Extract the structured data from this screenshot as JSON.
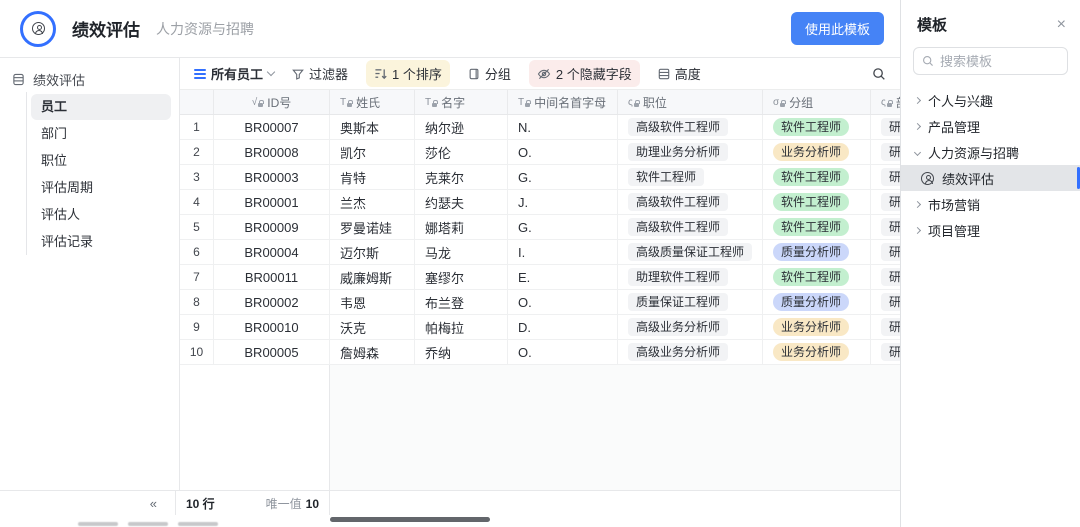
{
  "app": {
    "title": "绩效评估",
    "subtitle": "人力资源与招聘",
    "use_template_button": "使用此模板"
  },
  "sidebar": {
    "root_label": "绩效评估",
    "items": [
      {
        "label": "员工",
        "active": true
      },
      {
        "label": "部门",
        "active": false
      },
      {
        "label": "职位",
        "active": false
      },
      {
        "label": "评估周期",
        "active": false
      },
      {
        "label": "评估人",
        "active": false
      },
      {
        "label": "评估记录",
        "active": false
      }
    ],
    "collapse_glyph": "«"
  },
  "toolbar": {
    "view_label": "所有员工",
    "filter_label": "过滤器",
    "sort_label": "1 个排序",
    "group_label": "分组",
    "hidden_fields_label": "2 个隐藏字段",
    "row_height_label": "高度"
  },
  "table": {
    "columns": [
      {
        "label": "ID号",
        "type": "formula",
        "glyph": "√"
      },
      {
        "label": "姓氏",
        "type": "text",
        "glyph": "T"
      },
      {
        "label": "名字",
        "type": "text",
        "glyph": "T"
      },
      {
        "label": "中间名首字母",
        "type": "text",
        "glyph": "T"
      },
      {
        "label": "职位",
        "type": "lookup",
        "glyph": "ς"
      },
      {
        "label": "分组",
        "type": "rollup",
        "glyph": "σ"
      },
      {
        "label": "部门",
        "type": "lookup",
        "glyph": "ς"
      }
    ],
    "rows": [
      {
        "num": "1",
        "id": "BR00007",
        "last": "奥斯本",
        "first": "纳尔逊",
        "middle": "N.",
        "position": "高级软件工程师",
        "group": "软件工程师",
        "group_color": "green",
        "dept": "研发"
      },
      {
        "num": "2",
        "id": "BR00008",
        "last": "凯尔",
        "first": "莎伦",
        "middle": "O.",
        "position": "助理业务分析师",
        "group": "业务分析师",
        "group_color": "yellow",
        "dept": "研发"
      },
      {
        "num": "3",
        "id": "BR00003",
        "last": "肯特",
        "first": "克莱尔",
        "middle": "G.",
        "position": "软件工程师",
        "group": "软件工程师",
        "group_color": "green",
        "dept": "研发"
      },
      {
        "num": "4",
        "id": "BR00001",
        "last": "兰杰",
        "first": "约瑟夫",
        "middle": "J.",
        "position": "高级软件工程师",
        "group": "软件工程师",
        "group_color": "green",
        "dept": "研发"
      },
      {
        "num": "5",
        "id": "BR00009",
        "last": "罗曼诺娃",
        "first": "娜塔莉",
        "middle": "G.",
        "position": "高级软件工程师",
        "group": "软件工程师",
        "group_color": "green",
        "dept": "研发"
      },
      {
        "num": "6",
        "id": "BR00004",
        "last": "迈尔斯",
        "first": "马龙",
        "middle": "I.",
        "position": "高级质量保证工程师",
        "group": "质量分析师",
        "group_color": "blue",
        "dept": "研发"
      },
      {
        "num": "7",
        "id": "BR00011",
        "last": "威廉姆斯",
        "first": "塞缪尔",
        "middle": "E.",
        "position": "助理软件工程师",
        "group": "软件工程师",
        "group_color": "green",
        "dept": "研发"
      },
      {
        "num": "8",
        "id": "BR00002",
        "last": "韦恩",
        "first": "布兰登",
        "middle": "O.",
        "position": "质量保证工程师",
        "group": "质量分析师",
        "group_color": "blue",
        "dept": "研发"
      },
      {
        "num": "9",
        "id": "BR00010",
        "last": "沃克",
        "first": "帕梅拉",
        "middle": "D.",
        "position": "高级业务分析师",
        "group": "业务分析师",
        "group_color": "yellow",
        "dept": "研发"
      },
      {
        "num": "10",
        "id": "BR00005",
        "last": "詹姆森",
        "first": "乔纳",
        "middle": "O.",
        "position": "高级业务分析师",
        "group": "业务分析师",
        "group_color": "yellow",
        "dept": "研发"
      }
    ]
  },
  "statusbar": {
    "row_count": "10 行",
    "unique_label": "唯一值",
    "unique_value": "10"
  },
  "panel": {
    "title": "模板",
    "close_glyph": "×",
    "search_placeholder": "搜索模板",
    "items": [
      {
        "label": "个人与兴趣"
      },
      {
        "label": "产品管理"
      },
      {
        "label": "人力资源与招聘"
      },
      {
        "label": "绩效评估"
      },
      {
        "label": "市场营销"
      },
      {
        "label": "项目管理"
      }
    ]
  },
  "colors": {
    "accent_blue": "#3370ff",
    "button_blue": "#4583f6",
    "tag_green": "#c3efcf",
    "tag_yellow": "#f9e8c5",
    "tag_blue": "#cbd7fa",
    "tag_gray": "#f2f3f5",
    "sort_highlight": "#fbf4dc",
    "hidden_highlight": "#fbeceb"
  }
}
